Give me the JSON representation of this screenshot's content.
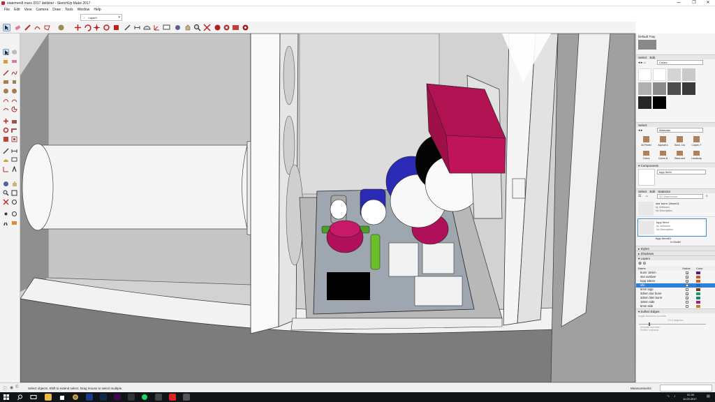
{
  "window": {
    "title": "statemen8 mars 2017 dekkiter - SketchUp Make 2017",
    "controls": [
      "—",
      "❐",
      "✕"
    ]
  },
  "menu": [
    "File",
    "Edit",
    "View",
    "Camera",
    "Draw",
    "Tools",
    "Window",
    "Help"
  ],
  "layer_dropdown": {
    "check": "✓",
    "value": "Layer0"
  },
  "toolbar_icons": [
    "select-tool",
    "eraser-tool",
    "pencil-tool",
    "arc-tool",
    "shape-tool",
    "push-pull-tool",
    "move-tool",
    "rotate-tool",
    "scale-tool",
    "offset-tool",
    "tape-measure-tool",
    "dimension-tool",
    "protractor-tool",
    "text-tool",
    "axes-tool",
    "orbit-tool",
    "pan-tool",
    "zoom-tool",
    "zoom-extents-tool",
    "warehouse-icon",
    "extension-warehouse-icon",
    "share-model-icon",
    "sandbox-icon"
  ],
  "tray": {
    "title": "Default Tray",
    "materials_top": {
      "tabs": [
        "Select",
        "Edit"
      ],
      "library": "Colors",
      "swatches": [
        "#ffffff",
        "#ffffff",
        "#d4d4d4",
        "#c9c9c9",
        "#b0b0b0",
        "#8c8c8c",
        "#6e6e6e",
        "#4d4d4d",
        "#3a3a3a",
        "#262626",
        "#111111",
        "#000000"
      ]
    },
    "materials_select": {
      "label": "Select",
      "library": "Materials",
      "items": [
        "3d Printer",
        "Asphalt a",
        "Brick, Cla",
        "Carpet, F",
        "Colors",
        "Colors-N",
        "Glass and",
        "Landscap"
      ]
    },
    "components": {
      "title": "Components",
      "name": "topp 5mm",
      "tabs": [
        "Select",
        "Edit",
        "Statistics"
      ],
      "search_placeholder": "3D Warehouse",
      "items": [
        {
          "name": "stor burnr 18mm01",
          "by": "by Unknown",
          "desc": "No Description"
        },
        {
          "name": "topp 5mm",
          "by": "by Unknown",
          "desc": "No Description"
        },
        {
          "name": "topp 5mm01",
          "by": "",
          "desc": ""
        }
      ],
      "footer": "In Model"
    },
    "sections": [
      "Styles",
      "Shadows",
      "Layers"
    ],
    "layers": {
      "headers": [
        "Name",
        "Visible",
        "Color"
      ],
      "rows": [
        {
          "name": "burnr 18mm",
          "visible": true,
          "color": "#5a1a8a"
        },
        {
          "name": "stor avstiver",
          "visible": true,
          "color": "#c85a1e"
        },
        {
          "name": "topp 18mm",
          "visible": true,
          "color": "#e05a10"
        },
        {
          "name": "elle",
          "visible": true,
          "color": "#1a6ec8",
          "selected": true
        },
        {
          "name": "5mm topp",
          "visible": false,
          "color": "#7a3a1a"
        },
        {
          "name": "3dmm stor burnr",
          "visible": true,
          "color": "#1a9a7a"
        },
        {
          "name": "3dmm liten burnr",
          "visible": true,
          "color": "#1a8a5a"
        },
        {
          "name": "18mm side",
          "visible": false,
          "color": "#a01a8a"
        },
        {
          "name": "5mm side",
          "visible": false,
          "color": "#d07a1a"
        }
      ]
    },
    "soften": {
      "title": "Soften Edges",
      "angle_label": "Angle between normals",
      "angle_value": "20.0 degrees",
      "options": [
        "Smooth normals",
        "Soften coplanar"
      ]
    }
  },
  "status": {
    "message": "Select objects. Shift to extend select. Drag mouse to select multiple.",
    "measurements_label": "Measurements"
  },
  "taskbar": {
    "time": "02.30",
    "date": "11.03.2017"
  }
}
